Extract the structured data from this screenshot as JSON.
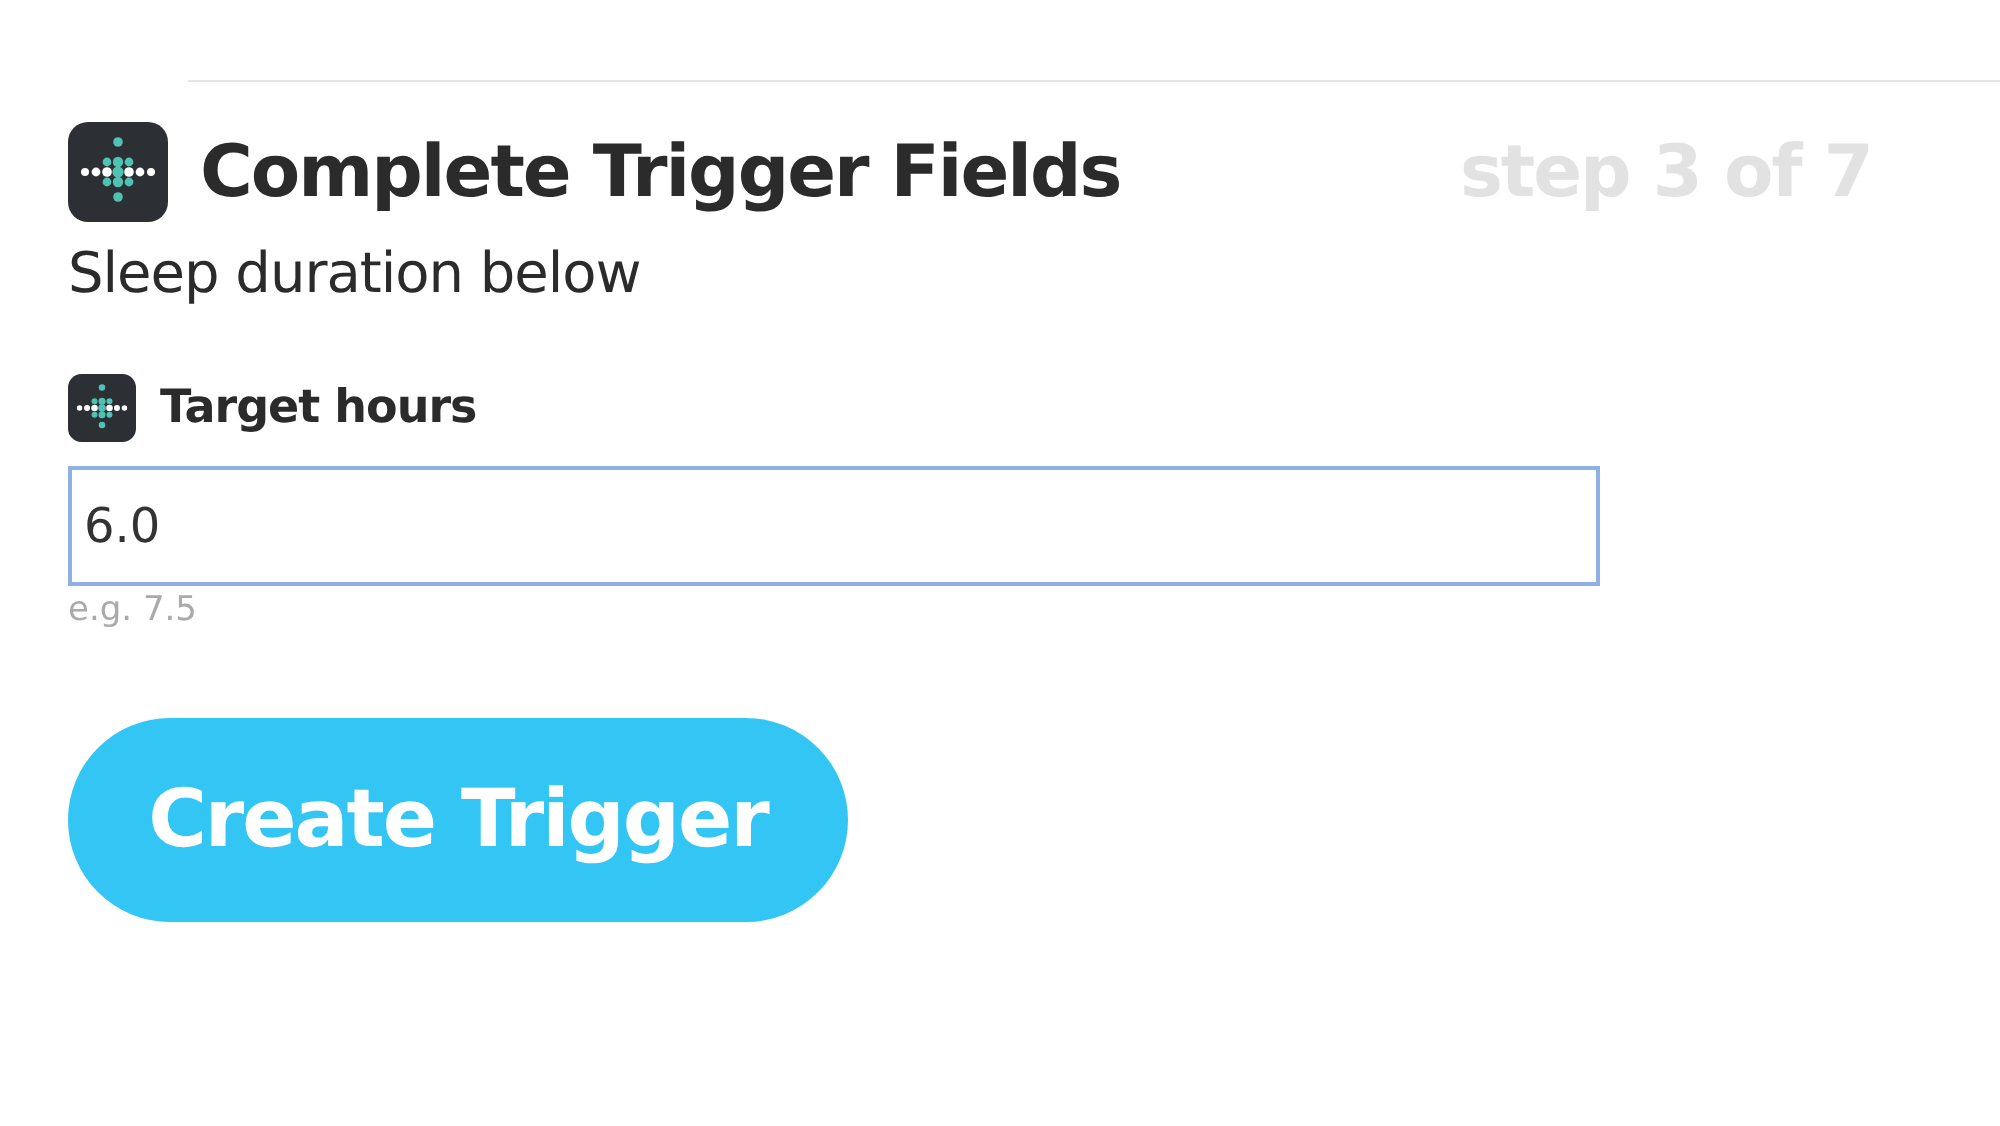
{
  "header": {
    "title": "Complete Trigger Fields",
    "step": "step 3 of 7",
    "subtitle": "Sleep duration below"
  },
  "field": {
    "label": "Target hours",
    "value": "6.0",
    "hint": "e.g. 7.5"
  },
  "button": {
    "label": "Create Trigger"
  }
}
